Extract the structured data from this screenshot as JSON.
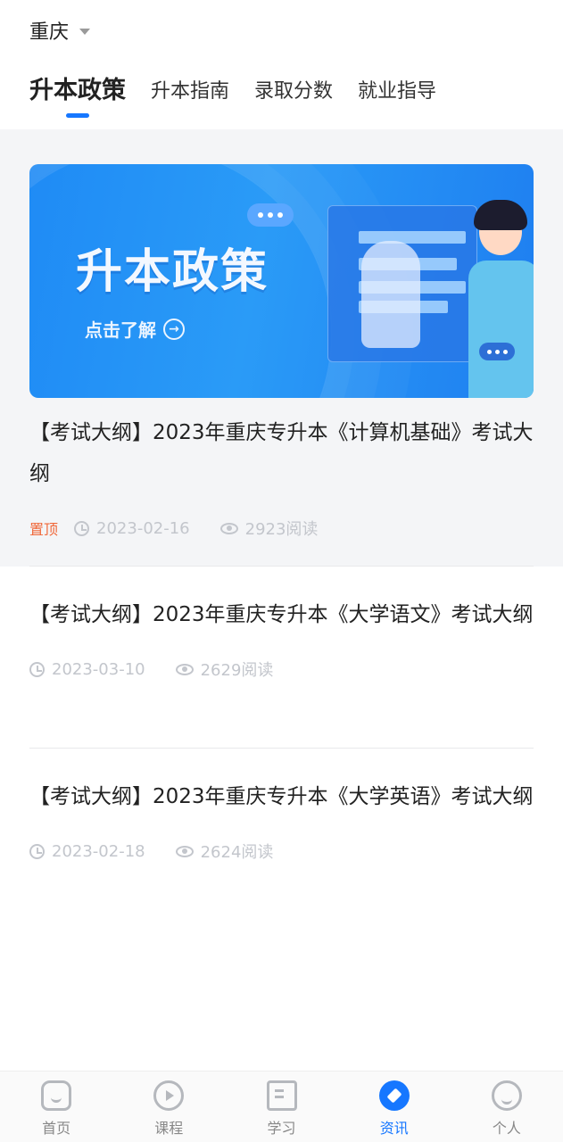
{
  "header": {
    "city": "重庆",
    "tabs": [
      {
        "label": "升本政策",
        "active": true
      },
      {
        "label": "升本指南",
        "active": false
      },
      {
        "label": "录取分数",
        "active": false
      },
      {
        "label": "就业指导",
        "active": false
      }
    ]
  },
  "banner": {
    "title": "升本政策",
    "cta": "点击了解"
  },
  "articles": [
    {
      "title": "【考试大纲】2023年重庆专升本《计算机基础》考试大纲",
      "pinned": "置顶",
      "date": "2023-02-16",
      "reads": "2923阅读"
    },
    {
      "title": "【考试大纲】2023年重庆专升本《大学语文》考试大纲",
      "date": "2023-03-10",
      "reads": "2629阅读"
    },
    {
      "title": "【考试大纲】2023年重庆专升本《大学英语》考试大纲",
      "date": "2023-02-18",
      "reads": "2624阅读"
    }
  ],
  "tabbar": {
    "items": [
      {
        "label": "首页",
        "icon": "home-icon"
      },
      {
        "label": "课程",
        "icon": "play-circle-icon"
      },
      {
        "label": "学习",
        "icon": "book-icon"
      },
      {
        "label": "资讯",
        "icon": "compass-icon",
        "active": true
      },
      {
        "label": "个人",
        "icon": "smile-icon"
      }
    ]
  },
  "colors": {
    "accent": "#1677ff",
    "pinned": "#f0683a",
    "meta": "#c3c6cc"
  }
}
